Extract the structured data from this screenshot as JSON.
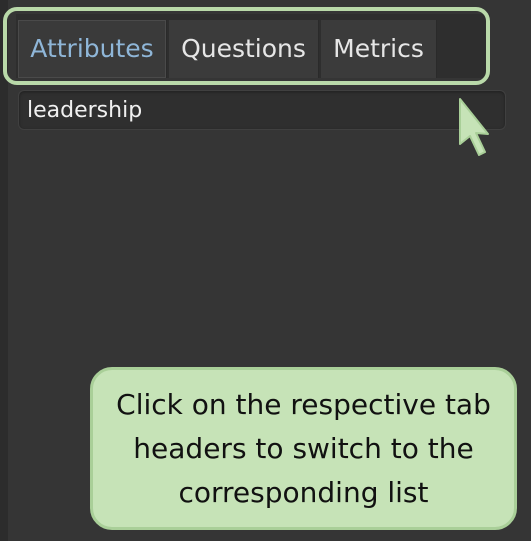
{
  "tabs": [
    {
      "label": "Attributes",
      "active": true
    },
    {
      "label": "Questions",
      "active": false
    },
    {
      "label": "Metrics",
      "active": false
    }
  ],
  "list": {
    "items": [
      "leadership"
    ]
  },
  "callout": {
    "text": "Click on the respective tab headers to switch to the corresponding list"
  },
  "colors": {
    "background": "#353535",
    "active_tab_text": "#8fb6d8",
    "highlight": "#b9d9a9",
    "callout_fill": "#c6e3b7"
  },
  "icons": {
    "pointer": "pointer-arrow-icon"
  }
}
